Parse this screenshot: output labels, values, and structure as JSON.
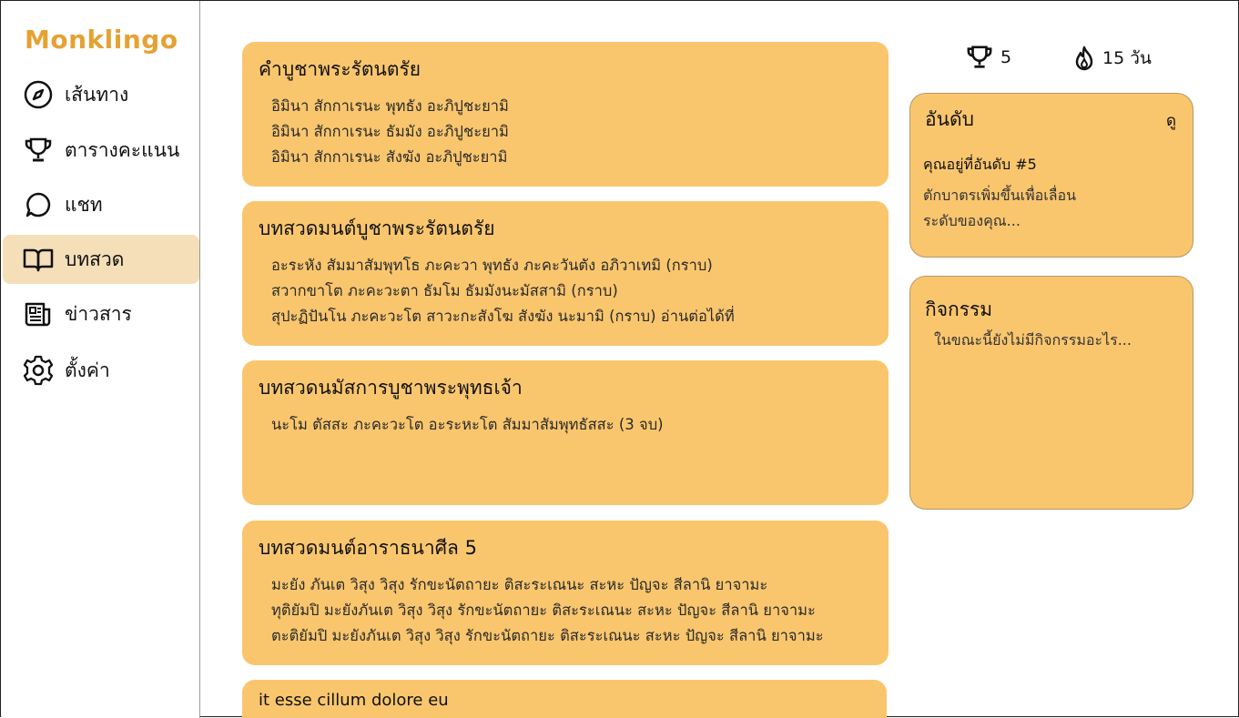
{
  "app": {
    "name": "Monklingo",
    "brand_color": "#e5a233"
  },
  "sidebar": {
    "items": [
      {
        "label": "เส้นทาง",
        "icon": "compass-icon"
      },
      {
        "label": "ตารางคะแนน",
        "icon": "trophy-icon"
      },
      {
        "label": "แชท",
        "icon": "chat-bubble-icon"
      },
      {
        "label": "บทสวด",
        "icon": "open-book-icon",
        "active": true
      },
      {
        "label": "ข่าวสาร",
        "icon": "newspaper-icon"
      },
      {
        "label": "ตั้งค่า",
        "icon": "gear-icon"
      }
    ]
  },
  "chants": [
    {
      "title": "คำบูชาพระรัตนตรัย",
      "lines": [
        "อิมินา สักกาเรนะ พุทธัง อะภิปูชะยามิ",
        "อิมินา สักกาเรนะ ธัมมัง อะภิปูชะยามิ",
        "อิมินา สักกาเรนะ สังฆัง อะภิปูชะยามิ"
      ]
    },
    {
      "title": "บทสวดมนต์บูชาพระรัตนตรัย",
      "lines": [
        "อะระหัง สัมมาสัมพุทโธ ภะคะวา พุทธัง ภะคะวันตัง อภิวาเทมิ (กราบ)",
        "สวากขาโต ภะคะวะตา ธัมโม ธัมมังนะมัสสามิ (กราบ)",
        "สุปะฏิปันโน ภะคะวะโต สาวะกะสังโฆ สังฆัง นะมามิ (กราบ) อ่านต่อได้ที่"
      ]
    },
    {
      "title": "บทสวดนมัสการบูชาพระพุทธเจ้า",
      "lines": [
        "นะโม ตัสสะ ภะคะวะโต อะระหะโต สัมมาสัมพุทธัสสะ (3 จบ)"
      ]
    },
    {
      "title": "บทสวดมนต์อาราธนาศีล 5",
      "lines": [
        "มะยัง ภันเต วิสุง วิสุง รักขะนัตถายะ ติสะระเณนะ สะหะ ปัญจะ สีลานิ ยาจามะ",
        "ทุติยัมปิ มะยังภันเต วิสุง วิสุง รักขะนัตถายะ ติสะระเณนะ สะหะ ปัญจะ สีลานิ ยาจามะ",
        "ตะติยัมปิ มะยังภันเต วิสุง วิสุง รักขะนัตถายะ ติสะระเณนะ สะหะ ปัญจะ สีลานิ ยาจามะ"
      ]
    },
    {
      "title": "it esse cillum dolore eu",
      "lines": []
    }
  ],
  "stats": {
    "trophies": "5",
    "streak": "15 วัน"
  },
  "ranking": {
    "title": "อันดับ",
    "view_link": "ดู",
    "rank_text": "คุณอยู่ที่อันดับ #5",
    "hint_line1": "ตักบาตรเพิ่มขึ้นเพื่อเลื่อน",
    "hint_line2": "ระดับของคุณ..."
  },
  "activity": {
    "title": "กิจกรรม",
    "empty_text": "ในขณะนี้ยังไม่มีกิจกรรมอะไร..."
  },
  "colors": {
    "card": "#f9c66e",
    "active_nav": "#f5dfb8"
  }
}
